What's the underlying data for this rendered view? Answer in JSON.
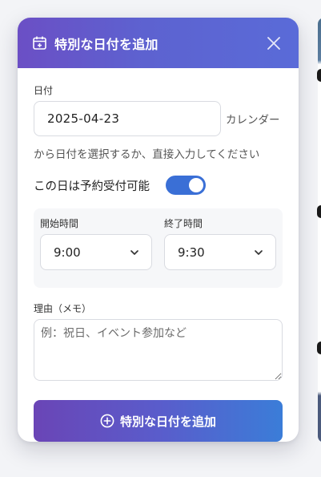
{
  "modal": {
    "title": "特別な日付を追加",
    "header_icon": "calendar-plus-icon",
    "close_icon": "close-icon"
  },
  "date": {
    "label": "日付",
    "value": "2025-04-23",
    "hint_part1": "カレンダー",
    "hint_part2": "から日付を選択するか、直接入力してください"
  },
  "availability": {
    "label": "この日は予約受付可能",
    "enabled": true
  },
  "time": {
    "start_label": "開始時間",
    "start_value": "9:00",
    "end_label": "終了時間",
    "end_value": "9:30"
  },
  "memo": {
    "label": "理由（メモ）",
    "placeholder": "例：祝日、イベント参加など"
  },
  "submit": {
    "label": "特別な日付を追加",
    "icon": "plus-circle-icon"
  },
  "colors": {
    "header_start": "#6b4fc5",
    "header_end": "#5a6bd8",
    "toggle_on": "#3a6fd6",
    "button_start": "#6a45b6",
    "button_end": "#3b7dd8"
  }
}
